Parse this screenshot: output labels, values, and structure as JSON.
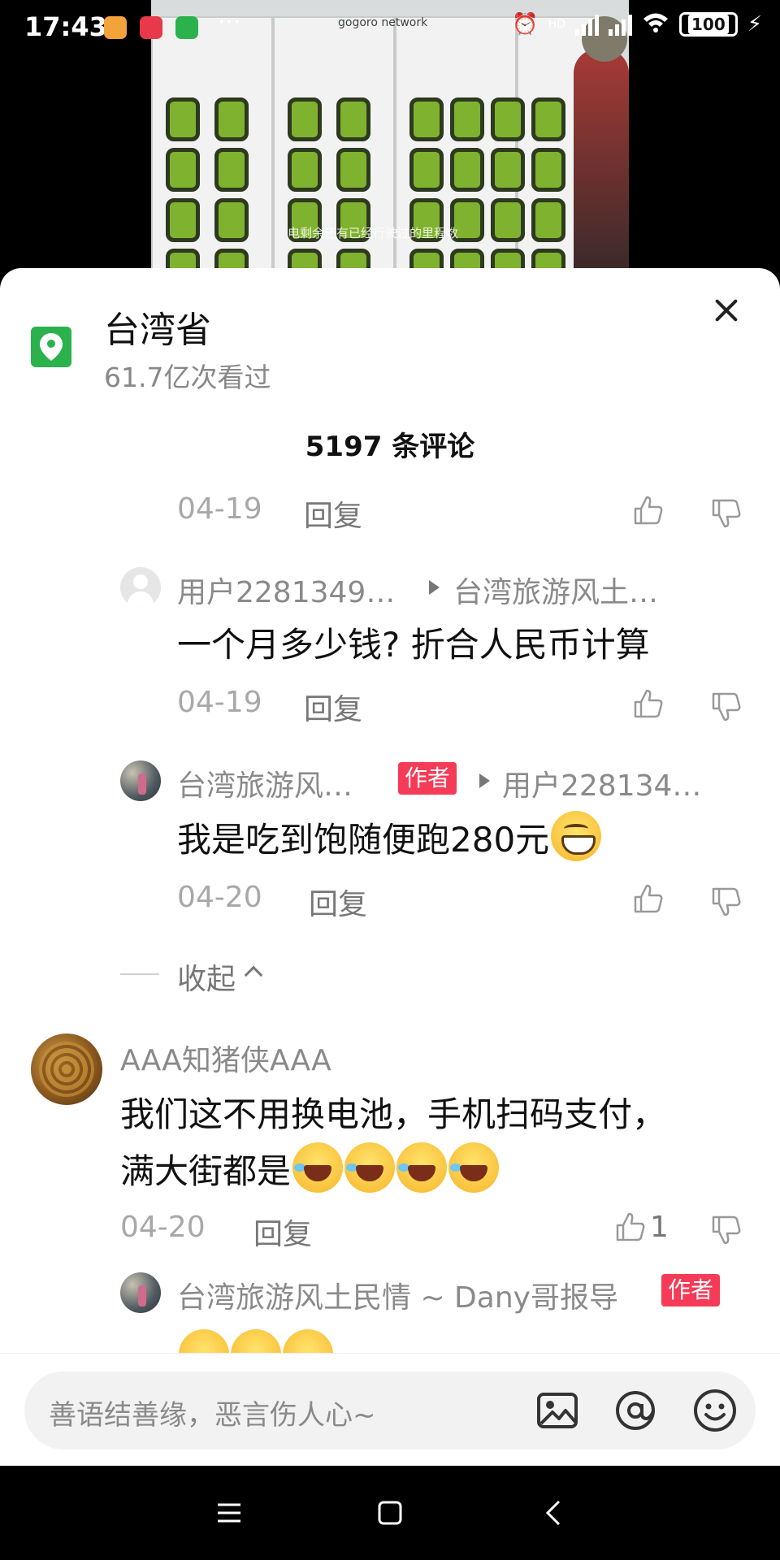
{
  "status_bar": {
    "time": "17:43",
    "battery": "100",
    "hd": "HD"
  },
  "video": {
    "brand": "gogoro network",
    "caption": "电剩余还有已经行驶过的里程数"
  },
  "location": {
    "name": "台湾省",
    "views": "61.7亿次看过"
  },
  "comments_header": "5197 条评论",
  "comments": [
    {
      "date": "04-19",
      "reply_label": "回复"
    },
    {
      "user": "用户2281349…",
      "reply_to": "台湾旅游风土…",
      "text": "一个月多少钱? 折合人民币计算",
      "date": "04-19",
      "reply_label": "回复"
    },
    {
      "user": "台湾旅游风…",
      "author_badge": "作者",
      "reply_to": "用户228134…",
      "text": "我是吃到饱随便跑280元",
      "date": "04-20",
      "reply_label": "回复"
    },
    {
      "user": "AAA知猪侠AAA",
      "text_line1": "我们这不用换电池，手机扫码支付，",
      "text_line2": "满大街都是",
      "date": "04-20",
      "reply_label": "回复",
      "likes": "1"
    },
    {
      "user": "台湾旅游风土民情 ~ Dany哥报导",
      "author_badge": "作者"
    }
  ],
  "collapse_label": "收起",
  "input": {
    "placeholder": "善语结善缘，恶言伤人心~"
  },
  "icons": {
    "location": "location-pin-icon",
    "close": "close-icon",
    "like": "thumbs-up-icon",
    "dislike": "thumbs-down-icon",
    "image": "image-icon",
    "mention": "at-icon",
    "emoji": "emoji-icon"
  },
  "colors": {
    "accent_green": "#2bb24c",
    "author_badge": "#f53b57"
  }
}
